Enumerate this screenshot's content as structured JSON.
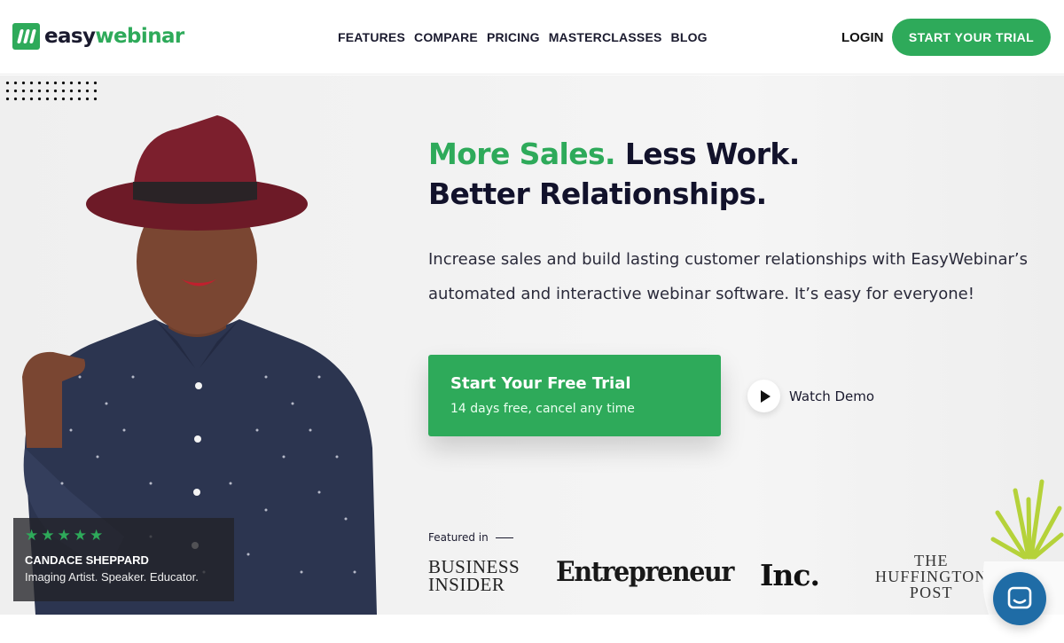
{
  "brand": {
    "logo_part1": "easy",
    "logo_part2": "webinar",
    "green": "#2eaa5a",
    "dark": "#12122b"
  },
  "nav": {
    "items": [
      "FEATURES",
      "COMPARE",
      "PRICING",
      "MASTERCLASSES",
      "BLOG"
    ],
    "login": "LOGIN",
    "trial_button": "START YOUR TRIAL"
  },
  "hero": {
    "headline_green": "More Sales.",
    "headline_dark": "Less Work.",
    "headline_line2": "Better Relationships.",
    "lede_line1": "Increase sales and build lasting customer relationships with EasyWebinar’s",
    "lede_line2": "automated and interactive webinar software. It’s easy for everyone!",
    "cta_title": "Start Your Free Trial",
    "cta_subtitle": "14 days free, cancel any time",
    "watch_demo": "Watch Demo",
    "featured_label": "Featured in",
    "press": {
      "business_insider_1": "BUSINESS",
      "business_insider_2": "INSIDER",
      "entrepreneur": "Entrepreneur",
      "inc": "Inc.",
      "huffington_1": "THE",
      "huffington_2": "HUFFINGTON",
      "huffington_3": "POST"
    }
  },
  "testimonial": {
    "stars": "★★★★★",
    "name": "CANDACE SHEPPARD",
    "role": "Imaging Artist. Speaker. Educator."
  },
  "icons": {
    "play": "play-icon",
    "chat": "chat-icon",
    "logo": "easywebinar-logo-icon"
  }
}
